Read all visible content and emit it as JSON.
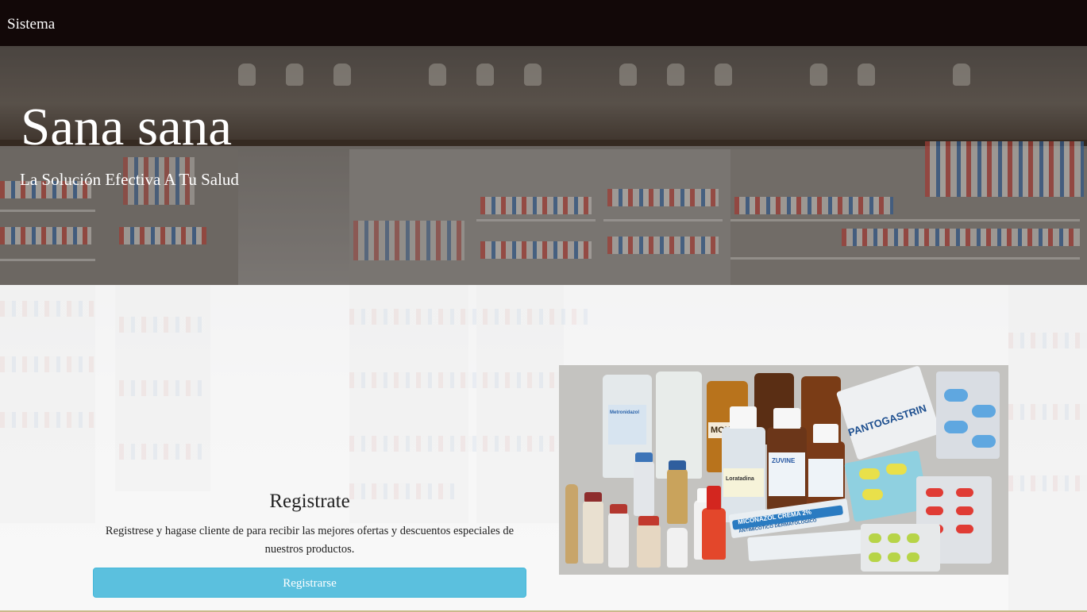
{
  "navbar": {
    "brand": "Sistema"
  },
  "hero": {
    "title": "Sana sana",
    "subtitle": "La Solución Efectiva A Tu Salud"
  },
  "register": {
    "title": "Registrate",
    "description": "Registrese y hagase cliente de para recibir las mejores ofertas y descuentos especiales de nuestros productos.",
    "button_label": "Registrarse"
  },
  "product_image": {
    "alt": "medicamentos",
    "package_labels": {
      "pantogastrin": "PANTOGASTRIN",
      "zuvine": "ZUVINE",
      "loratadina": "Loratadina",
      "miconazol": "MICONAZOL CREMA 2%",
      "antimicotico": "ANTIMICOTICO DERMATOLOGICO",
      "metronidazol": "Metronidazol",
      "mox": "MOX"
    }
  },
  "colors": {
    "navbar_bg": "#120808",
    "button_bg": "#5bc0de",
    "hero_text": "#ffffff",
    "body_text": "#222222"
  }
}
